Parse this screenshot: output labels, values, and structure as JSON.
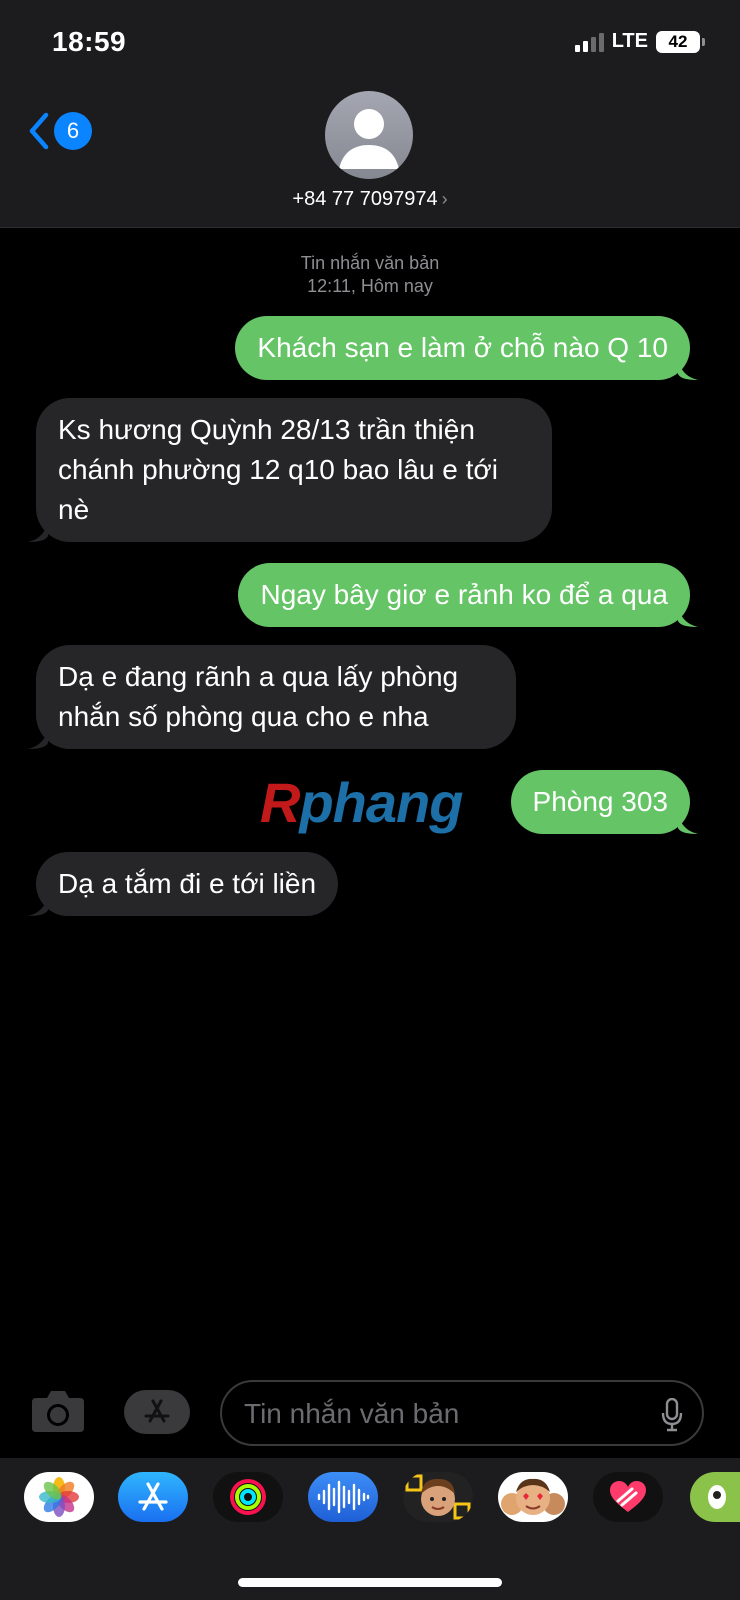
{
  "status_bar": {
    "time": "18:59",
    "network": "LTE",
    "battery": "42"
  },
  "header": {
    "back_count": "6",
    "contact": "+84 77 7097974",
    "contact_chevron": "›"
  },
  "conversation": {
    "timestamp_type": "Tin nhắn văn bản",
    "timestamp_time": "12:11, Hôm nay",
    "messages": [
      {
        "direction": "out",
        "text": "Khách sạn e làm ở chỗ nào Q 10"
      },
      {
        "direction": "in",
        "text": "Ks hương Quỳnh 28/13 trần thiện chánh phường 12 q10 bao lâu e tới nè"
      },
      {
        "direction": "out",
        "text": "Ngay bây giơ e rảnh ko để a qua"
      },
      {
        "direction": "in",
        "text": "Dạ e đang rãnh a qua lấy phòng nhắn số phòng qua cho e nha"
      },
      {
        "direction": "out",
        "text": "Phòng 303"
      },
      {
        "direction": "in",
        "text": "Dạ a tắm đi e tới liền"
      }
    ]
  },
  "watermark": {
    "first": "R",
    "rest": "phang"
  },
  "composer": {
    "placeholder": "Tin nhắn văn bản"
  },
  "app_drawer": {
    "apps": [
      "photos-app-icon",
      "app-store-app-icon",
      "activity-app-icon",
      "audio-message-app-icon",
      "memoji-app-icon",
      "memoji-stickers-app-icon",
      "digital-touch-app-icon",
      "more-app-icon"
    ]
  },
  "colors": {
    "outgoing": "#65c466",
    "incoming": "#262629",
    "accent": "#0a84ff"
  }
}
